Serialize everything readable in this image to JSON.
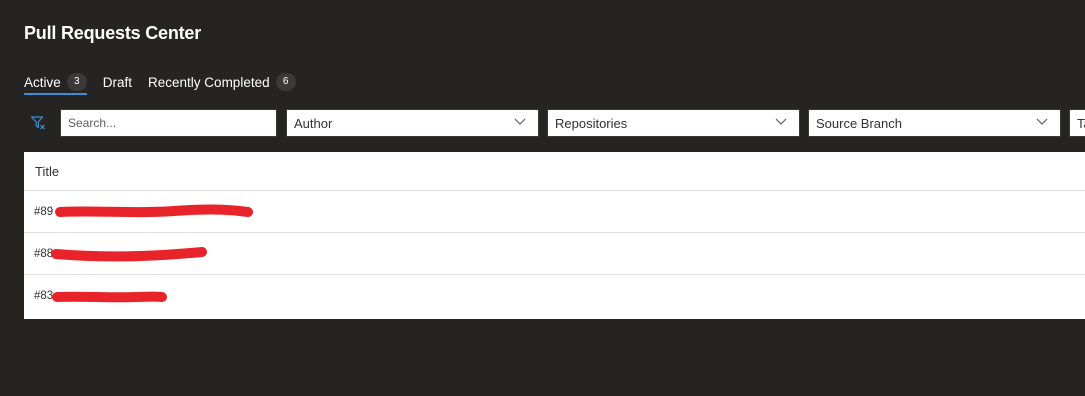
{
  "page": {
    "title": "Pull Requests Center"
  },
  "tabs": [
    {
      "label": "Active",
      "count": "3"
    },
    {
      "label": "Draft",
      "count": ""
    },
    {
      "label": "Recently Completed",
      "count": "6"
    }
  ],
  "filters": {
    "search_placeholder": "Search...",
    "dropdowns": [
      {
        "label": "Author"
      },
      {
        "label": "Repositories"
      },
      {
        "label": "Source Branch"
      },
      {
        "label": "Ta"
      }
    ]
  },
  "table": {
    "columns": [
      "Title"
    ],
    "rows": [
      {
        "id": "#89"
      },
      {
        "id": "#88"
      },
      {
        "id": "#83"
      }
    ]
  },
  "colors": {
    "background": "#252423",
    "accent": "#3a8fd8",
    "redaction": "#e8242a"
  },
  "icons": {
    "filter": "filter-icon",
    "dropdown": "chevron-down-icon"
  }
}
